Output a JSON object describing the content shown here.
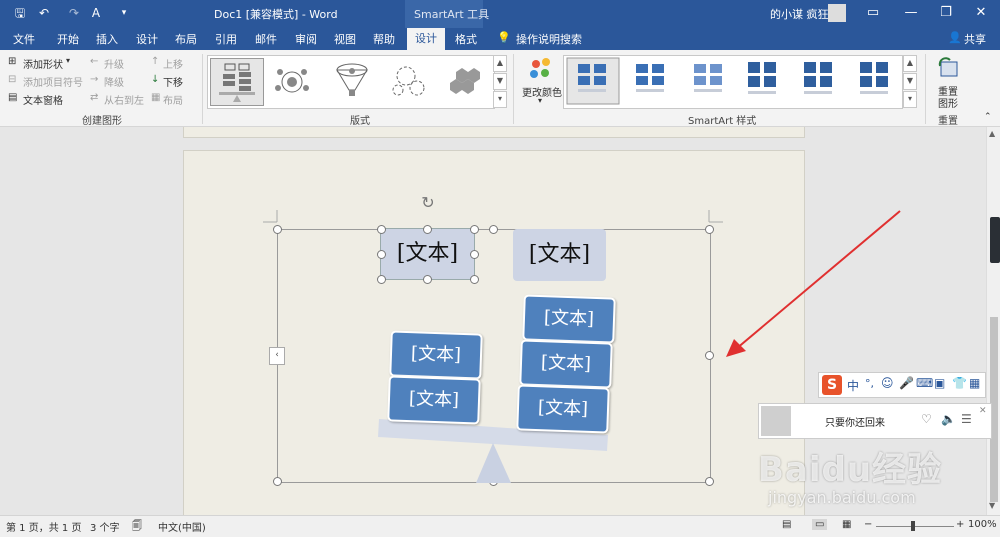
{
  "window": {
    "title": "Doc1 [兼容模式] - Word",
    "context_tab": "SmartArt 工具",
    "user": "的小谋 疯狂"
  },
  "tabs": [
    "文件",
    "开始",
    "插入",
    "设计",
    "布局",
    "引用",
    "邮件",
    "审阅",
    "视图",
    "帮助",
    "设计",
    "格式"
  ],
  "active_tab_index": 10,
  "tell_me": "操作说明搜索",
  "share": "共享",
  "ribbon": {
    "create_graphic": {
      "add_shape": "添加形状",
      "add_bullet": "添加项目符号",
      "text_pane": "文本窗格",
      "promote": "升级",
      "demote": "降级",
      "right_to_left": "从右到左",
      "move_up": "上移",
      "move_down": "下移",
      "layout": "布局",
      "group_label": "创建图形"
    },
    "layouts": {
      "group_label": "版式"
    },
    "styles": {
      "change_colors": "更改颜色",
      "group_label": "SmartArt 样式"
    },
    "reset": {
      "reset_graphic_1": "重置",
      "reset_graphic_2": "图形",
      "group_label": "重置"
    }
  },
  "smartart": {
    "top_left": "[文本]",
    "top_right": "[文本]",
    "left_boxes": [
      "[文本]",
      "[文本]"
    ],
    "right_boxes": [
      "[文本]",
      "[文本]",
      "[文本]"
    ]
  },
  "ime": {
    "lang": "中"
  },
  "music": {
    "song": "只要你还回来"
  },
  "watermark": {
    "line1": "Baidu经验",
    "line2": "jingyan.baidu.com"
  },
  "status": {
    "page": "第 1 页，共 1 页",
    "words": "3 个字",
    "language": "中文(中国)",
    "zoom": "100%"
  },
  "colors": {
    "accent": "#2b579a",
    "shape": "#4f81bd",
    "arrow": "#e03030"
  }
}
